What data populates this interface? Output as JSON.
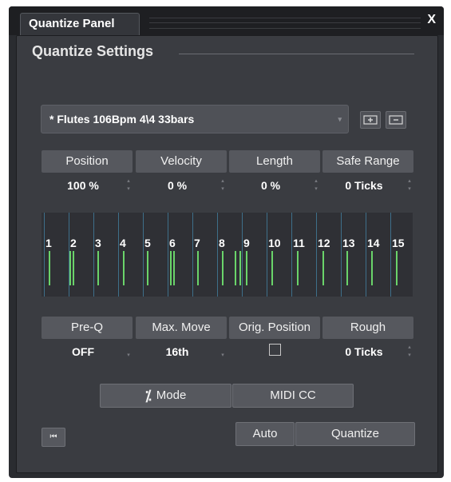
{
  "window": {
    "tab_title": "Quantize Panel",
    "close_label": "X"
  },
  "settings": {
    "title": "Quantize Settings",
    "preset": "* Flutes  106Bpm  4\\4  33bars"
  },
  "top_params": [
    {
      "label": "Position",
      "value": "100 %"
    },
    {
      "label": "Velocity",
      "value": "0 %"
    },
    {
      "label": "Length",
      "value": "0 %"
    },
    {
      "label": "Safe Range",
      "value": "0 Ticks"
    }
  ],
  "grid_numbers": [
    "1",
    "2",
    "3",
    "4",
    "5",
    "6",
    "7",
    "8",
    "9",
    "10",
    "11",
    "12",
    "13",
    "14",
    "15"
  ],
  "bottom_params": [
    {
      "label": "Pre-Q",
      "value": "OFF"
    },
    {
      "label": "Max. Move",
      "value": "16th"
    },
    {
      "label": "Orig. Position",
      "value": ""
    },
    {
      "label": "Rough",
      "value": "0 Ticks"
    }
  ],
  "buttons": {
    "mode_icon": "⁒",
    "mode": "Mode",
    "midi_cc": "MIDI CC",
    "auto": "Auto",
    "quantize": "Quantize",
    "rewind_icon": "⏮"
  },
  "colors": {
    "grid_line": "#3e6f8a",
    "note": "#6ad46a"
  }
}
